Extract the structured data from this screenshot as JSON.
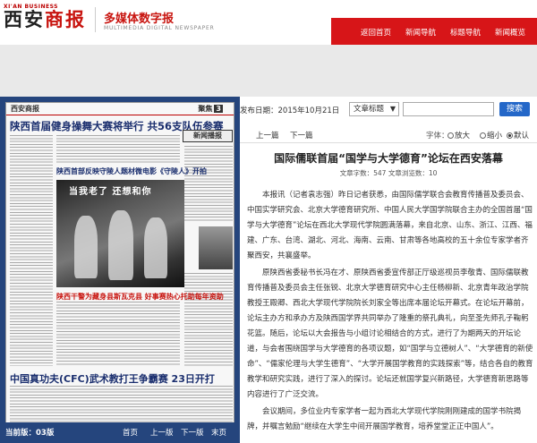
{
  "header": {
    "logo_en": "XI'AN BUSINESS",
    "logo_cn_1": "西安",
    "logo_cn_2": "商报",
    "tagline_cn": "多媒体数字报",
    "tagline_en": "MULTIMEDIA DIGITAL NEWSPAPER",
    "nav": [
      "返回首页",
      "新闻导航",
      "标题导航",
      "新闻概览"
    ],
    "brand_color": "#d71518"
  },
  "toolbar": {
    "date_label": "发布日期：2015年10月21日",
    "select_value": "文章标题",
    "search_placeholder": "",
    "search_button": "搜索"
  },
  "paper": {
    "mini_logo": "西安商报",
    "page_tag": "聚焦",
    "page_num": "3",
    "ribbon": "新闻播报",
    "headline_1": "陕西首届健身操舞大赛将举行 共56支队伍参赛",
    "headline_2": "陕西首部反映守陵人题材微电影《守陵人》开拍",
    "headline_3": "陕西干警为藏身县斯瓦克县 好事赛热心托助每年资助",
    "headline_4": "中国真功夫(CFC)武术教打王争霸赛 23日开打",
    "photo_caption": "当我老了 还想和你"
  },
  "pager": {
    "current_label": "当前版：",
    "current_page": "03版",
    "links": [
      "首页",
      "上一版",
      "下一版",
      "末页"
    ]
  },
  "article": {
    "prev": "上一篇",
    "next": "下一篇",
    "font_label": "字体：",
    "font_options": [
      "放大",
      "缩小",
      "默认"
    ],
    "title": "国际儒联首届“国学与大学德育”论坛在西安落幕",
    "meta": "文章字数：547  文章浏览数：10",
    "paragraphs": [
      "本报讯（记者袁志强）昨日记者获悉，由国际儒学联合会教育传播普及委员会、中国实学研究会、北京大学德育研究所、中国人民大学国学院联合主办的全国首届“国学与大学德育”论坛在西北大学现代学院圆满落幕，来自北京、山东、浙江、江西、福建、广东、台湾、湖北、河北、海南、云南、甘肃等各地高校的五十余位专家学者齐聚西安，共襄盛举。",
      "原陕西省委秘书长冯在才、原陕西省委宣传部正厅级巡视员李敬青、国际儒联教育传播普及委员会主任张锐、北京大学德育研究中心主任杨柳新、北京青年政治学院教授王殿卿、西北大学现代学院院长刘家全等出席本届论坛开幕式。在论坛开幕前，论坛主办方和承办方及陕西国学界共同举办了隆重的祭孔典礼，向至圣先师孔子鞠躬花篮。随后，论坛以大会报告与小组讨论相结合的方式，进行了为期两天的开坛论道，与会者围绕国学与大学德育的各项议题，如“国学与立德树人”、“大学德育的新使命”、“儒家伦理与大学生德育”、“大学开展国学教育的实践探索”等，结合各自的教育教学和研究实践，进行了深入的探讨。论坛还就国学复兴新路径，大学德育新思路等内容进行了广泛交流。",
      "会议期间，多位业内专家学者一起为西北大学现代学院刚刚建成的国学书院揭牌，并嘱言勉励“继续在大学生中间开展国学教育，培养堂堂正正中国人”。"
    ]
  }
}
